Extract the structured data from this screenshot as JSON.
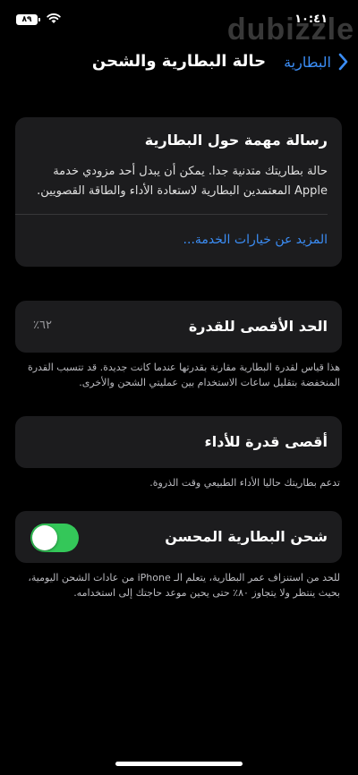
{
  "status_bar": {
    "battery_level": "٨٩",
    "time": "١٠:٤١",
    "watermark": "dubizzle"
  },
  "nav": {
    "back_label": "البطارية",
    "title": "حالة البطارية والشحن"
  },
  "important_message": {
    "title": "رسالة مهمة حول البطارية",
    "body": "حالة بطاريتك متدنية جدا. يمكن أن يبدل أحد مزودي خدمة Apple المعتمدين البطارية لاستعادة الأداء والطاقة القصويين.",
    "link": "المزيد عن خيارات الخدمة..."
  },
  "maximum_capacity": {
    "label": "الحد الأقصى للقدرة",
    "value": "٦٢٪",
    "footnote": "هذا قياس لقدرة البطارية مقارنة بقدرتها عندما كانت جديدة. قد تتسبب القدرة المنخفضة بتقليل ساعات الاستخدام بين عمليتي الشحن والأخرى."
  },
  "peak_performance": {
    "label": "أقصى قدرة للأداء",
    "footnote": "تدعم بطاريتك حاليا الأداء الطبيعي وقت الذروة."
  },
  "optimized_charging": {
    "label": "شحن البطارية المحسن",
    "enabled": true,
    "footnote": "للحد من استنزاف عمر البطارية، يتعلم الـ iPhone من عادات الشحن اليومية، بحيث ينتظر ولا يتجاوز ٨٠٪ حتى يحين موعد حاجتك إلى استخدامه."
  },
  "colors": {
    "background": "#000000",
    "card": "#1c1c1e",
    "accent_blue": "#3b8df5",
    "toggle_on": "#34c759"
  }
}
